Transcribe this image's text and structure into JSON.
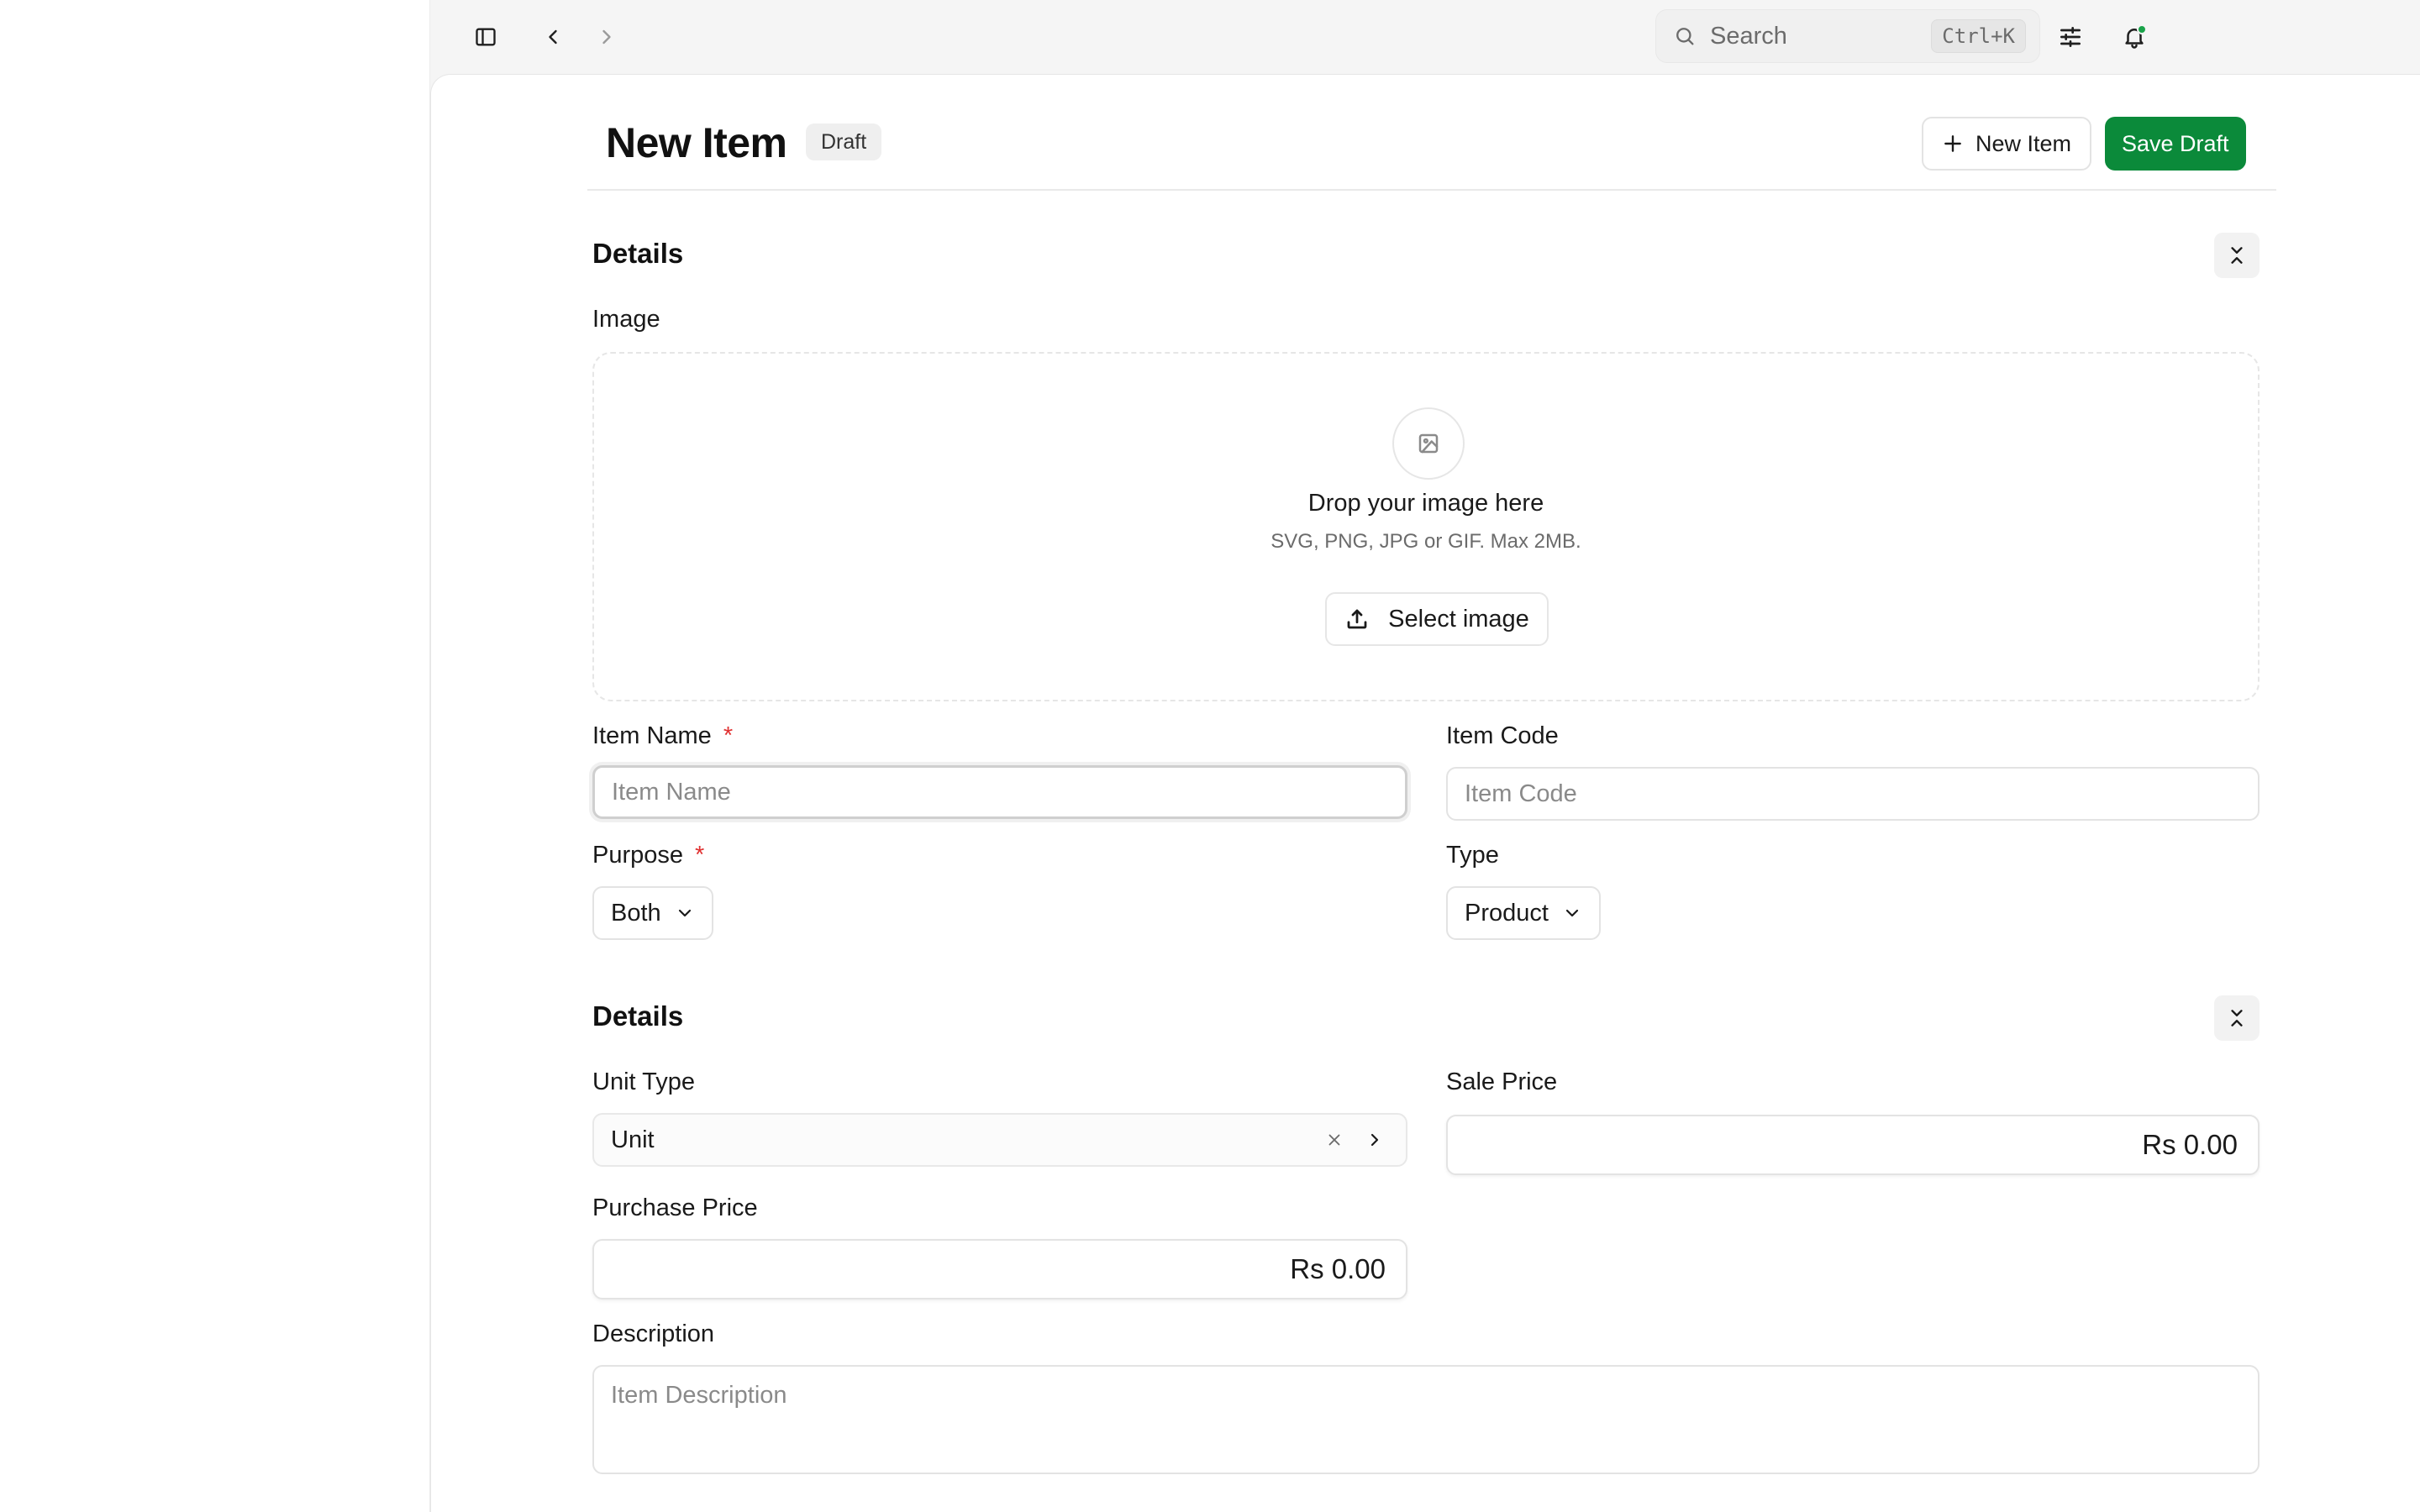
{
  "topbar": {
    "search_label": "Search",
    "search_shortcut": "Ctrl+K",
    "icons": [
      "sidebar-toggle-icon",
      "chevron-left-icon",
      "chevron-right-icon",
      "sliders-icon",
      "bell-icon"
    ],
    "notification_dot_color": "#1aa34a"
  },
  "header": {
    "title": "New Item",
    "status_badge": "Draft",
    "new_item_label": "New Item",
    "save_label": "Save Draft",
    "accent_color": "#0b8a3a"
  },
  "section1": {
    "title": "Details",
    "image_label": "Image",
    "dropzone": {
      "title": "Drop your image here",
      "subtitle": "SVG, PNG, JPG or GIF. Max 2MB.",
      "button_label": "Select image"
    },
    "item_name": {
      "label": "Item Name",
      "required": "*",
      "placeholder": "Item Name",
      "value": ""
    },
    "item_code": {
      "label": "Item Code",
      "placeholder": "Item Code",
      "value": ""
    },
    "purpose": {
      "label": "Purpose",
      "required": "*",
      "value": "Both"
    },
    "type": {
      "label": "Type",
      "value": "Product"
    }
  },
  "section2": {
    "title": "Details",
    "unit_type": {
      "label": "Unit Type",
      "value": "Unit"
    },
    "sale_price": {
      "label": "Sale Price",
      "value": "Rs 0.00"
    },
    "purchase_price": {
      "label": "Purchase Price",
      "value": "Rs 0.00"
    },
    "description": {
      "label": "Description",
      "placeholder": "Item Description",
      "value": ""
    }
  }
}
